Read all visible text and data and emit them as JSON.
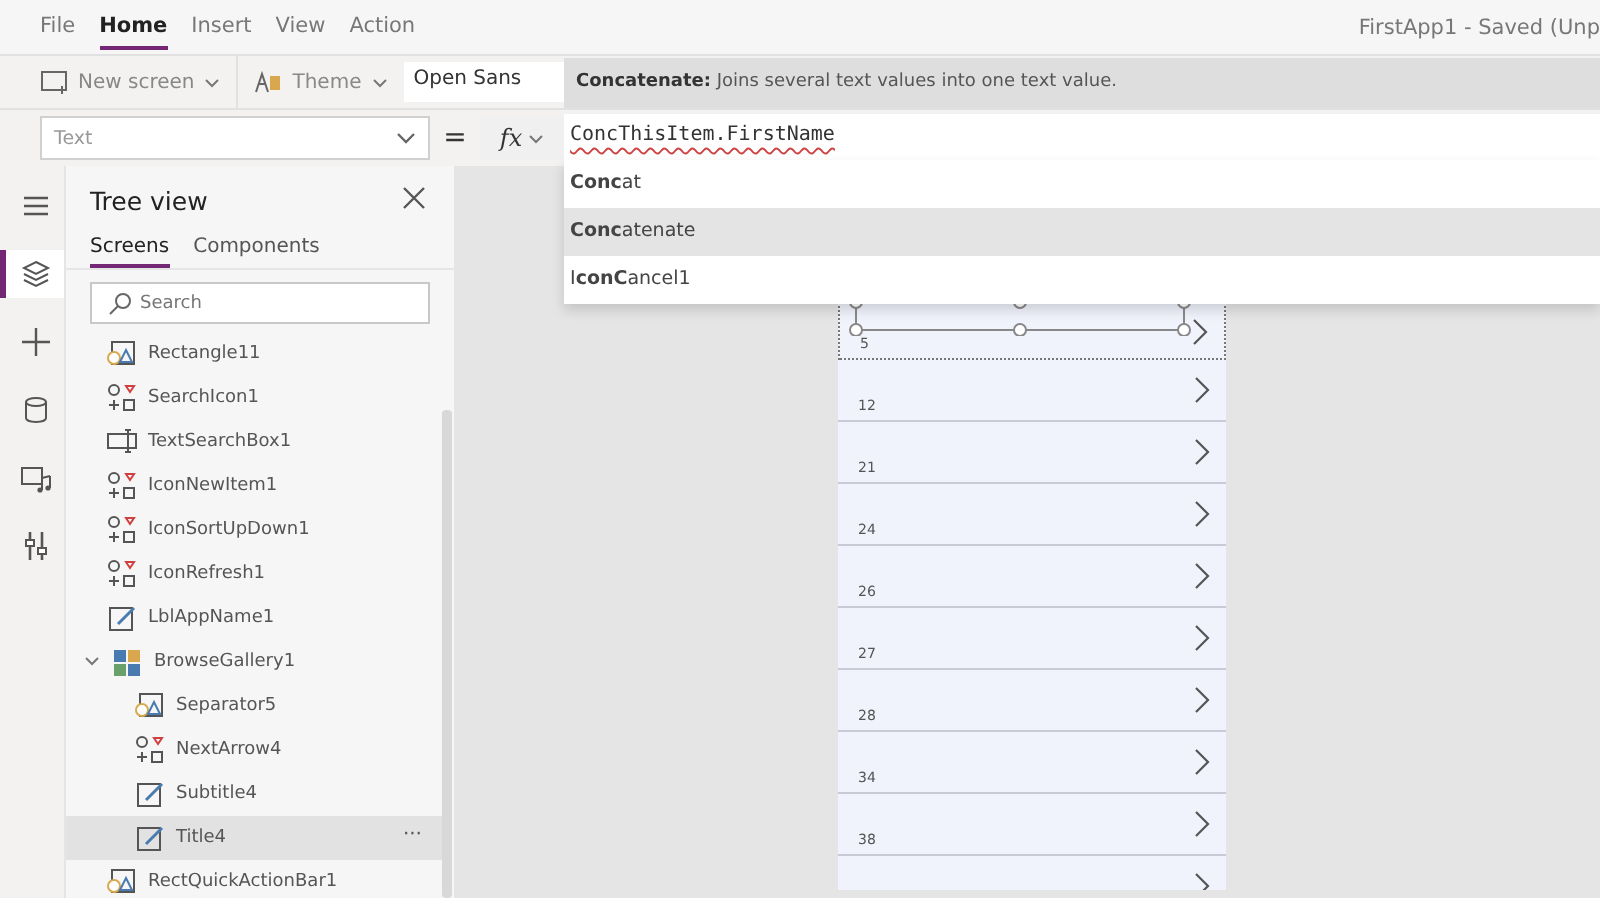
{
  "menu": [
    {
      "label": "File",
      "selected": false
    },
    {
      "label": "Home",
      "selected": true
    },
    {
      "label": "Insert",
      "selected": false
    },
    {
      "label": "View",
      "selected": false
    },
    {
      "label": "Action",
      "selected": false
    }
  ],
  "window": {
    "title": "FirstApp1 - Saved (Unp"
  },
  "toolbar": {
    "new_screen": "New screen",
    "theme": "Theme",
    "font": "Open Sans"
  },
  "tooltip": "**Concatenate:** Joins several text values into one text value.",
  "formula_bar": {
    "property": "Text",
    "equals": "=",
    "fx": "fx",
    "formula": "ConcThisItem.FirstName"
  },
  "suggestions": [
    {
      "label": "**Conc**at",
      "selected": false
    },
    {
      "label": "**Conc**atenate",
      "selected": true
    },
    {
      "label": "I**conC**ancel1",
      "selected": false
    }
  ],
  "rail": [
    {
      "kind": "menu",
      "selected": false
    },
    {
      "kind": "tree",
      "selected": true
    },
    {
      "kind": "insert",
      "selected": false
    },
    {
      "kind": "data",
      "selected": false
    },
    {
      "kind": "media",
      "selected": false
    },
    {
      "kind": "tools",
      "selected": false
    }
  ],
  "tree_view": {
    "title": "Tree view",
    "tabs": [
      {
        "label": "Screens",
        "selected": true
      },
      {
        "label": "Components",
        "selected": false
      }
    ],
    "search": {
      "placeholder": "Search"
    },
    "items": [
      {
        "label": "Rectangle11",
        "kind": "shape",
        "selected": false
      },
      {
        "label": "SearchIcon1",
        "kind": "icon",
        "selected": false
      },
      {
        "label": "TextSearchBox1",
        "kind": "input",
        "selected": false
      },
      {
        "label": "IconNewItem1",
        "kind": "icon",
        "selected": false
      },
      {
        "label": "IconSortUpDown1",
        "kind": "icon",
        "selected": false
      },
      {
        "label": "IconRefresh1",
        "kind": "icon",
        "selected": false
      },
      {
        "label": "LblAppName1",
        "kind": "label",
        "selected": false
      },
      {
        "label": "BrowseGallery1",
        "kind": "gallery",
        "selected": false,
        "expanded": true,
        "children": [
          {
            "label": "Separator5",
            "kind": "shape",
            "selected": false
          },
          {
            "label": "NextArrow4",
            "kind": "icon",
            "selected": false
          },
          {
            "label": "Subtitle4",
            "kind": "label",
            "selected": false
          },
          {
            "label": "Title4",
            "kind": "label",
            "selected": true,
            "more": "···"
          }
        ]
      },
      {
        "label": "RectQuickActionBar1",
        "kind": "shape",
        "selected": false
      }
    ]
  },
  "gallery": {
    "rows": [
      {
        "value": "5",
        "selected": true
      },
      {
        "value": "12",
        "selected": false
      },
      {
        "value": "21",
        "selected": false
      },
      {
        "value": "24",
        "selected": false
      },
      {
        "value": "26",
        "selected": false
      },
      {
        "value": "27",
        "selected": false
      },
      {
        "value": "28",
        "selected": false
      },
      {
        "value": "34",
        "selected": false
      },
      {
        "value": "38",
        "selected": false
      },
      {
        "value": "",
        "selected": false
      }
    ]
  }
}
